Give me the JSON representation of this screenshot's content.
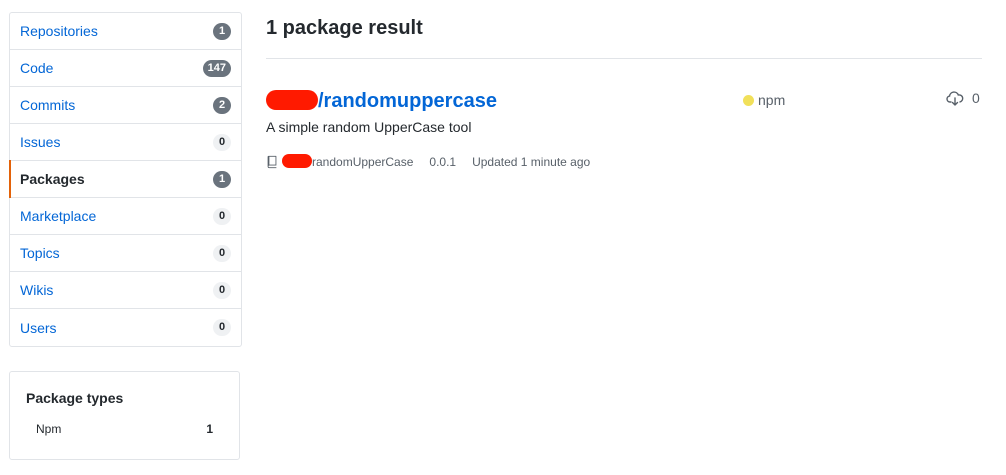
{
  "sidebar": {
    "items": [
      {
        "label": "Repositories",
        "count": "1"
      },
      {
        "label": "Code",
        "count": "147"
      },
      {
        "label": "Commits",
        "count": "2"
      },
      {
        "label": "Issues",
        "count": "0"
      },
      {
        "label": "Packages",
        "count": "1"
      },
      {
        "label": "Marketplace",
        "count": "0"
      },
      {
        "label": "Topics",
        "count": "0"
      },
      {
        "label": "Wikis",
        "count": "0"
      },
      {
        "label": "Users",
        "count": "0"
      }
    ],
    "selected": "Packages"
  },
  "package_types": {
    "title": "Package types",
    "items": [
      {
        "label": "Npm",
        "count": "1"
      }
    ]
  },
  "results": {
    "title": "1 package result",
    "packages": [
      {
        "name": "/randomuppercase",
        "description": "A simple random UpperCase tool",
        "repo": "randomUpperCase",
        "version": "0.0.1",
        "updated": "Updated 1 minute ago",
        "language": "npm",
        "language_color": "#f1e05a",
        "downloads": "0"
      }
    ]
  },
  "icons": {
    "repo": "repo-icon",
    "downloads": "cloud-download-icon"
  },
  "colors": {
    "link": "#0366d6",
    "selected_accent": "#e36209",
    "redaction": "#ff1a00"
  }
}
